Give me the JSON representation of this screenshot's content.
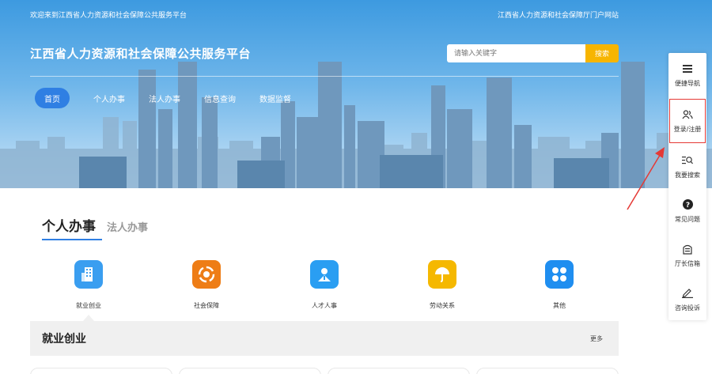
{
  "header": {
    "welcome_text": "欢迎来到江西省人力资源和社会保障公共服务平台",
    "portal_link": "江西省人力资源和社会保障厅门户网站",
    "site_title": "江西省人力资源和社会保障公共服务平台"
  },
  "search": {
    "placeholder": "请输入关键字",
    "button_label": "搜索"
  },
  "nav": {
    "items": [
      {
        "label": "首页"
      },
      {
        "label": "个人办事"
      },
      {
        "label": "法人办事"
      },
      {
        "label": "信息查询"
      },
      {
        "label": "数据监督"
      }
    ]
  },
  "tabs": {
    "active": "个人办事",
    "inactive": "法人办事"
  },
  "services": [
    {
      "label": "就业创业",
      "color": "#3a9ef0",
      "icon": "building-icon"
    },
    {
      "label": "社会保障",
      "color": "#ee7d16",
      "icon": "shield-circle-icon"
    },
    {
      "label": "人才人事",
      "color": "#2a9ef2",
      "icon": "person-icon"
    },
    {
      "label": "劳动关系",
      "color": "#f5b800",
      "icon": "umbrella-icon"
    },
    {
      "label": "其他",
      "color": "#1f8ef0",
      "icon": "grid-icon"
    }
  ],
  "section": {
    "title": "就业创业",
    "more": "更多"
  },
  "sidebar": {
    "items": [
      {
        "label": "便捷导航",
        "icon": "menu-icon"
      },
      {
        "label": "登录/注册",
        "icon": "users-icon"
      },
      {
        "label": "我要搜索",
        "icon": "search-list-icon"
      },
      {
        "label": "常见问题",
        "icon": "question-icon"
      },
      {
        "label": "厅长信箱",
        "icon": "mailbox-icon"
      },
      {
        "label": "咨询投诉",
        "icon": "edit-icon"
      }
    ]
  },
  "colors": {
    "accent": "#2f7fe3",
    "search_button": "#f7b500",
    "highlight": "#e53935"
  }
}
